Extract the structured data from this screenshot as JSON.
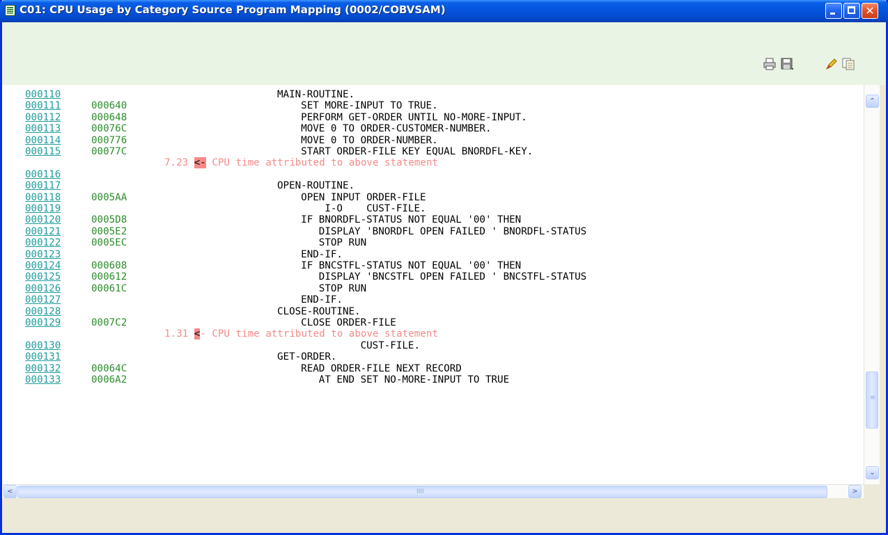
{
  "window": {
    "title": "C01:  CPU Usage by Category Source Program Mapping (0002/COBVSAM)",
    "close_glyph": "✕"
  },
  "toolbar": {
    "icons": [
      "print-icon",
      "save-icon",
      "highlight-icon",
      "copy-icon"
    ]
  },
  "listing": [
    {
      "line": "000110",
      "addr": "",
      "src": "MAIN-ROUTINE."
    },
    {
      "line": "000111",
      "addr": "000640",
      "src": "    SET MORE-INPUT TO TRUE."
    },
    {
      "line": "000112",
      "addr": "000648",
      "src": "    PERFORM GET-ORDER UNTIL NO-MORE-INPUT."
    },
    {
      "line": "000113",
      "addr": "00076C",
      "src": "    MOVE 0 TO ORDER-CUSTOMER-NUMBER."
    },
    {
      "line": "000114",
      "addr": "000776",
      "src": "    MOVE 0 TO ORDER-NUMBER."
    },
    {
      "line": "000115",
      "addr": "00077C",
      "src": "    START ORDER-FILE KEY EQUAL BNORDFL-KEY."
    },
    {
      "cpu": "7.23",
      "arrow": "<-",
      "text": " CPU time attributed to above statement"
    },
    {
      "line": "000116",
      "addr": "",
      "src": ""
    },
    {
      "line": "000117",
      "addr": "",
      "src": "OPEN-ROUTINE."
    },
    {
      "line": "000118",
      "addr": "0005AA",
      "src": "    OPEN INPUT ORDER-FILE"
    },
    {
      "line": "000119",
      "addr": "",
      "src": "        I-O    CUST-FILE."
    },
    {
      "line": "000120",
      "addr": "0005D8",
      "src": "    IF BNORDFL-STATUS NOT EQUAL '00' THEN"
    },
    {
      "line": "000121",
      "addr": "0005E2",
      "src": "       DISPLAY 'BNORDFL OPEN FAILED ' BNORDFL-STATUS"
    },
    {
      "line": "000122",
      "addr": "0005EC",
      "src": "       STOP RUN"
    },
    {
      "line": "000123",
      "addr": "",
      "src": "    END-IF."
    },
    {
      "line": "000124",
      "addr": "000608",
      "src": "    IF BNCSTFL-STATUS NOT EQUAL '00' THEN"
    },
    {
      "line": "000125",
      "addr": "000612",
      "src": "       DISPLAY 'BNCSTFL OPEN FAILED ' BNCSTFL-STATUS"
    },
    {
      "line": "000126",
      "addr": "00061C",
      "src": "       STOP RUN"
    },
    {
      "line": "000127",
      "addr": "",
      "src": "    END-IF."
    },
    {
      "line": "000128",
      "addr": "",
      "src": "CLOSE-ROUTINE."
    },
    {
      "line": "000129",
      "addr": "0007C2",
      "src": "    CLOSE ORDER-FILE"
    },
    {
      "cpu": "1.31",
      "arrow": "<",
      "text": "- CPU time attributed to above statement"
    },
    {
      "line": "000130",
      "addr": "",
      "src": "              CUST-FILE."
    },
    {
      "line": "000131",
      "addr": "",
      "src": "GET-ORDER."
    },
    {
      "line": "000132",
      "addr": "00064C",
      "src": "    READ ORDER-FILE NEXT RECORD"
    },
    {
      "line": "000133",
      "addr": "0006A2",
      "src": "       AT END SET NO-MORE-INPUT TO TRUE"
    }
  ],
  "scrollbars": {
    "up_glyph": "⌃",
    "down_glyph": "⌄",
    "left_glyph": "<",
    "right_glyph": ">",
    "grip_glyph": "≡",
    "hgrip_glyph": "IIII"
  }
}
